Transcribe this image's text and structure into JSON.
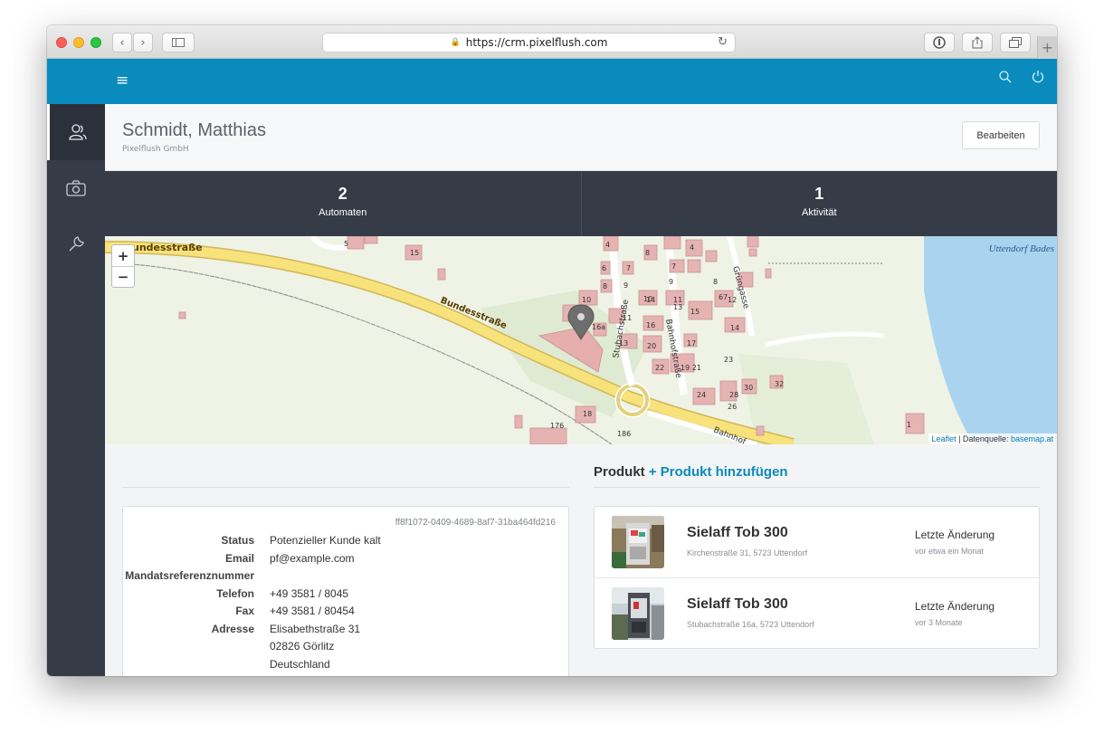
{
  "browser": {
    "url": "https://crm.pixelflush.com"
  },
  "customer": {
    "name": "Schmidt, Matthias",
    "company": "Pixelflush GmbH",
    "edit_label": "Bearbeiten",
    "id": "ff8f1072-0409-4689-8af7-31ba464fd216"
  },
  "stats": [
    {
      "value": "2",
      "label": "Automaten"
    },
    {
      "value": "1",
      "label": "Aktivität"
    }
  ],
  "map": {
    "zoom_in": "+",
    "zoom_out": "−",
    "attribution_leaflet": "Leaflet",
    "attribution_text": " | Datenquelle: ",
    "attribution_source": "basemap.at",
    "lake_label": "Uttendorf Bades",
    "road_left": "undesstraße",
    "road_mid": "Bundesstraße",
    "road_bottom": "Bahnhof",
    "street_stubach": "Stubachstraße",
    "street_bahnhof": "Bahnhofstraße",
    "street_grungasse": "Grüngasse",
    "house_numbers": [
      "4",
      "8",
      "7",
      "6",
      "9",
      "10",
      "16a",
      "11",
      "13",
      "14",
      "13",
      "11",
      "16",
      "15",
      "20",
      "17",
      "22",
      "19",
      "21",
      "23",
      "24",
      "28",
      "26",
      "30",
      "32",
      "18",
      "176",
      "186",
      "5",
      "15",
      "67",
      "12",
      "8",
      "1"
    ]
  },
  "details": {
    "fields": [
      {
        "label": "Status",
        "value": "Potenzieller Kunde kalt"
      },
      {
        "label": "Email",
        "value": "pf@example.com"
      },
      {
        "label": "Mandatsreferenznummer",
        "value": ""
      },
      {
        "label": "Telefon",
        "value": "+49 3581 / 8045"
      },
      {
        "label": "Fax",
        "value": "+49 3581 / 80454"
      },
      {
        "label": "Adresse",
        "value": "Elisabethstraße 31"
      },
      {
        "label": "",
        "value": "02826 Görlitz"
      },
      {
        "label": "",
        "value": "Deutschland"
      }
    ]
  },
  "products": {
    "title": "Produkt",
    "add_label": "+ Produkt hinzufügen",
    "items": [
      {
        "name": "Sielaff Tob 300",
        "address": "Kirchenstraße 31, 5723 Uttendorf",
        "change_label": "Letzte Änderung",
        "change_time": "vor etwa ein Monat"
      },
      {
        "name": "Sielaff Tob 300",
        "address": "Stubachstraße 16a, 5723 Uttendorf",
        "change_label": "Letzte Änderung",
        "change_time": "vor 3 Monate"
      }
    ]
  },
  "colors": {
    "topbar": "#0a8bbd",
    "sidebar": "#363b48",
    "accent_link": "#0a8bbd"
  }
}
